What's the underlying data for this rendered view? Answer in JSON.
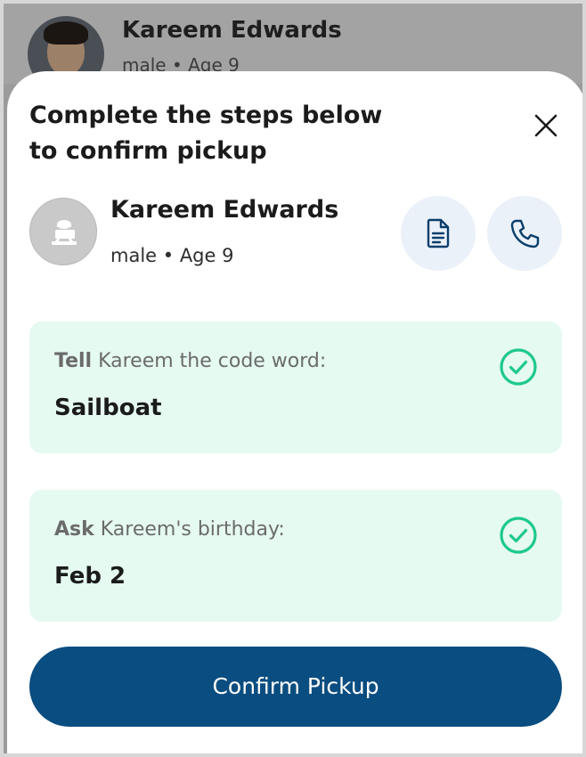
{
  "background_item": {
    "name": "Kareem Edwards",
    "subtitle": "male • Age 9"
  },
  "sheet": {
    "title": "Complete the steps below to confirm pickup"
  },
  "child": {
    "name": "Kareem Edwards",
    "subtitle": "male • Age 9"
  },
  "steps": [
    {
      "verb": "Tell",
      "prompt_rest": " Kareem the code word:",
      "answer": "Sailboat",
      "status_icon": "check-circle-icon"
    },
    {
      "verb": "Ask",
      "prompt_rest": " Kareem's birthday:",
      "answer": "Feb 2",
      "status_icon": "check-circle-icon"
    }
  ],
  "confirm_button": {
    "label": "Confirm Pickup"
  },
  "colors": {
    "primary": "#0a4d80",
    "success": "#1ec98b",
    "card_bg": "#e5faf1",
    "icon_btn_bg": "#eaf1f9"
  }
}
